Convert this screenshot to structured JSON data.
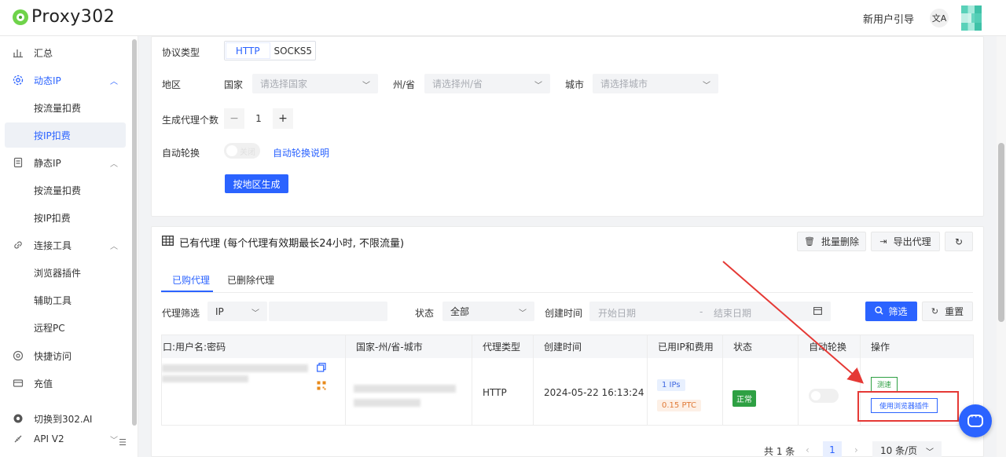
{
  "header": {
    "logo_text": "Proxy302",
    "guide_label": "新用户引导",
    "translate_glyph": "文A"
  },
  "sidebar": {
    "summary": "汇总",
    "dynamic_ip": "动态IP",
    "dynamic_by_traffic": "按流量扣费",
    "dynamic_by_ip": "按IP扣费",
    "static_ip": "静态IP",
    "static_by_traffic": "按流量扣费",
    "static_by_ip": "按IP扣费",
    "connect_tools": "连接工具",
    "browser_plugin": "浏览器插件",
    "aux_tools": "辅助工具",
    "remote_pc": "远程PC",
    "quick_access": "快捷访问",
    "recharge": "充值",
    "switch_302": "切换到302.AI",
    "api_v2": "API V2"
  },
  "form": {
    "protocol_label": "协议类型",
    "protocol_options": [
      "HTTP",
      "SOCKS5"
    ],
    "region_label": "地区",
    "country_label": "国家",
    "country_placeholder": "请选择国家",
    "state_label": "州/省",
    "state_placeholder": "请选择州/省",
    "city_label": "城市",
    "city_placeholder": "请选择城市",
    "count_label": "生成代理个数",
    "count_value": "1",
    "minus": "−",
    "plus": "+",
    "auto_rotate_label": "自动轮换",
    "auto_rotate_toggle_text": "关闭",
    "auto_rotate_help": "自动轮换说明",
    "generate_button": "按地区生成"
  },
  "proxies": {
    "title": "已有代理 (每个代理有效期最长24小时, 不限流量)",
    "batch_delete": "批量删除",
    "export": "导出代理",
    "tabs": [
      "已购代理",
      "已删除代理"
    ],
    "filter_label": "代理筛选",
    "filter_type": "IP",
    "status_label": "状态",
    "status_value": "全部",
    "created_label": "创建时间",
    "start_date": "开始日期",
    "date_sep": "-",
    "end_date": "结束日期",
    "filter_button": "筛选",
    "reset_button": "重置",
    "columns": [
      "口:用户名:密码",
      "国家-州/省-城市",
      "代理类型",
      "创建时间",
      "已用IP和费用",
      "状态",
      "自动轮换",
      "操作"
    ],
    "row": {
      "type": "HTTP",
      "created": "2024-05-22 16:13:24",
      "ips_used": "1 IPs",
      "cost": "0.15 PTC",
      "status": "正常",
      "action_speed": "测速",
      "action_plugin": "使用浏览器插件"
    }
  },
  "pager": {
    "total": "共 1 条",
    "current_page": "1",
    "page_size": "10 条/页"
  },
  "colors": {
    "primary": "#2b63ff",
    "success": "#2ea043",
    "annotation_red": "#e53935",
    "logo_green": "#6fd34a"
  }
}
